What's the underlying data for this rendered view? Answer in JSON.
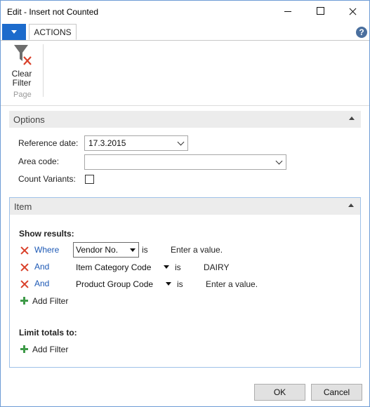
{
  "window": {
    "title": "Edit - Insert not Counted"
  },
  "ribbon": {
    "tab_actions": "ACTIONS",
    "help": "?",
    "clear_filter_line1": "Clear",
    "clear_filter_line2": "Filter",
    "group_page": "Page"
  },
  "options": {
    "header": "Options",
    "reference_date_label": "Reference date:",
    "reference_date_value": "17.3.2015",
    "area_code_label": "Area code:",
    "area_code_value": "",
    "count_variants_label": "Count Variants:",
    "count_variants_checked": false
  },
  "item": {
    "header": "Item",
    "show_results_label": "Show results:",
    "filters": [
      {
        "conj": "Where",
        "field": "Vendor No.",
        "op": "is",
        "value": "Enter a value."
      },
      {
        "conj": "And",
        "field": "Item Category Code",
        "op": "is",
        "value": "DAIRY"
      },
      {
        "conj": "And",
        "field": "Product Group Code",
        "op": "is",
        "value": "Enter a value."
      }
    ],
    "add_filter": "Add Filter",
    "limit_totals_label": "Limit totals to:",
    "add_filter_limit": "Add Filter"
  },
  "buttons": {
    "ok": "OK",
    "cancel": "Cancel"
  },
  "colors": {
    "accent": "#1c6bcc",
    "link": "#1d59b5",
    "delete": "#d9402a",
    "add": "#3e9a48"
  },
  "icons": [
    "clear-filter-icon",
    "help-icon",
    "delete-filter-icon",
    "add-filter-icon",
    "collapse-chevron-icon"
  ]
}
